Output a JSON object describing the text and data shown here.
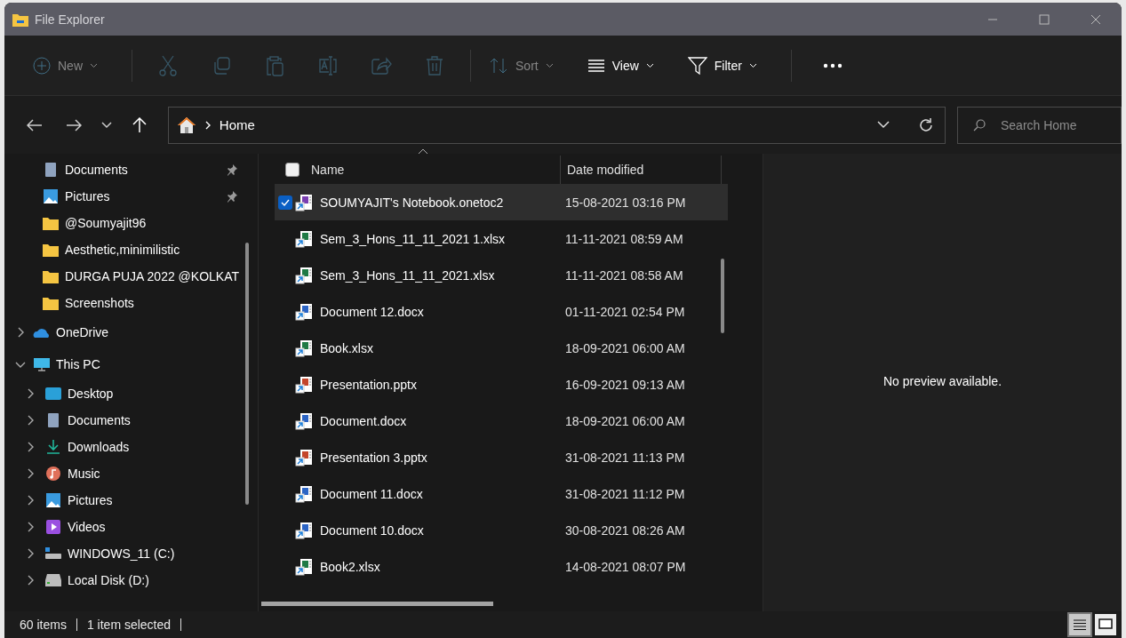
{
  "window": {
    "title": "File Explorer"
  },
  "toolbar": [
    {
      "kind": "labeled",
      "label": "New",
      "disabled": true
    },
    {
      "kind": "separator"
    },
    {
      "kind": "icon",
      "disabled": true
    },
    {
      "kind": "icon",
      "disabled": true
    },
    {
      "kind": "icon",
      "disabled": true
    },
    {
      "kind": "icon",
      "disabled": true
    },
    {
      "kind": "icon",
      "disabled": true
    },
    {
      "kind": "icon",
      "disabled": true
    },
    {
      "kind": "separator"
    },
    {
      "kind": "labeled",
      "label": "Sort",
      "disabled": true
    },
    {
      "kind": "labeled",
      "label": "View",
      "disabled": false
    },
    {
      "kind": "labeled",
      "label": "Filter",
      "disabled": false
    },
    {
      "kind": "separator"
    },
    {
      "kind": "more",
      "disabled": false
    }
  ],
  "address": {
    "location": "Home"
  },
  "search": {
    "placeholder": "Search Home"
  },
  "sidebar": {
    "quick_access": [
      {
        "label": "Documents",
        "kind": "documents",
        "pinned": true
      },
      {
        "label": "Pictures",
        "kind": "pictures",
        "pinned": true
      },
      {
        "label": "@Soumyajit96",
        "kind": "folder",
        "pinned": false
      },
      {
        "label": "Aesthetic,minimilistic",
        "kind": "folder",
        "pinned": false
      },
      {
        "label": "DURGA PUJA 2022 @KOLKAT",
        "kind": "folder",
        "pinned": false
      },
      {
        "label": "Screenshots",
        "kind": "folder",
        "pinned": false
      }
    ],
    "locations": [
      {
        "label": "OneDrive",
        "kind": "onedrive",
        "expanded": false
      },
      {
        "label": "This PC",
        "kind": "pc",
        "expanded": true,
        "children": [
          {
            "label": "Desktop",
            "kind": "desktop",
            "expanded": false
          },
          {
            "label": "Documents",
            "kind": "documents",
            "expanded": false
          },
          {
            "label": "Downloads",
            "kind": "downloads",
            "expanded": false
          },
          {
            "label": "Music",
            "kind": "music",
            "expanded": false
          },
          {
            "label": "Pictures",
            "kind": "pictures",
            "expanded": false
          },
          {
            "label": "Videos",
            "kind": "videos",
            "expanded": false
          },
          {
            "label": "WINDOWS_11 (C:)",
            "kind": "drive",
            "expanded": false
          },
          {
            "label": "Local Disk (D:)",
            "kind": "disk",
            "expanded": false
          }
        ]
      }
    ]
  },
  "table": {
    "select_all": {
      "checked": false
    },
    "columns": [
      {
        "label": "Name",
        "sorted": true
      },
      {
        "label": "Date modified",
        "sorted": false
      }
    ],
    "rows": [
      {
        "name": "SOUMYAJIT's Notebook.onetoc2",
        "date": "15-08-2021 03:16 PM",
        "kind": "onenote",
        "selected": true
      },
      {
        "name": "Sem_3_Hons_11_11_2021 1.xlsx",
        "date": "11-11-2021 08:59 AM",
        "kind": "excel",
        "selected": false
      },
      {
        "name": "Sem_3_Hons_11_11_2021.xlsx",
        "date": "11-11-2021 08:58 AM",
        "kind": "excel",
        "selected": false
      },
      {
        "name": "Document 12.docx",
        "date": "01-11-2021 02:54 PM",
        "kind": "word",
        "selected": false
      },
      {
        "name": "Book.xlsx",
        "date": "18-09-2021 06:00 AM",
        "kind": "excel",
        "selected": false
      },
      {
        "name": "Presentation.pptx",
        "date": "16-09-2021 09:13 AM",
        "kind": "powerpoint",
        "selected": false
      },
      {
        "name": "Document.docx",
        "date": "18-09-2021 06:00 AM",
        "kind": "word",
        "selected": false
      },
      {
        "name": "Presentation 3.pptx",
        "date": "31-08-2021 11:13 PM",
        "kind": "powerpoint",
        "selected": false
      },
      {
        "name": "Document 11.docx",
        "date": "31-08-2021 11:12 PM",
        "kind": "word",
        "selected": false
      },
      {
        "name": "Document 10.docx",
        "date": "30-08-2021 08:26 AM",
        "kind": "word",
        "selected": false
      },
      {
        "name": "Book2.xlsx",
        "date": "14-08-2021 08:07 PM",
        "kind": "excel",
        "selected": false
      }
    ]
  },
  "preview": {
    "message": "No preview available."
  },
  "status_bar": {
    "count": "60 items",
    "selection": "1 item selected",
    "views": [
      {
        "kind": "details",
        "selected": true
      },
      {
        "kind": "tiles",
        "selected": false
      }
    ]
  }
}
